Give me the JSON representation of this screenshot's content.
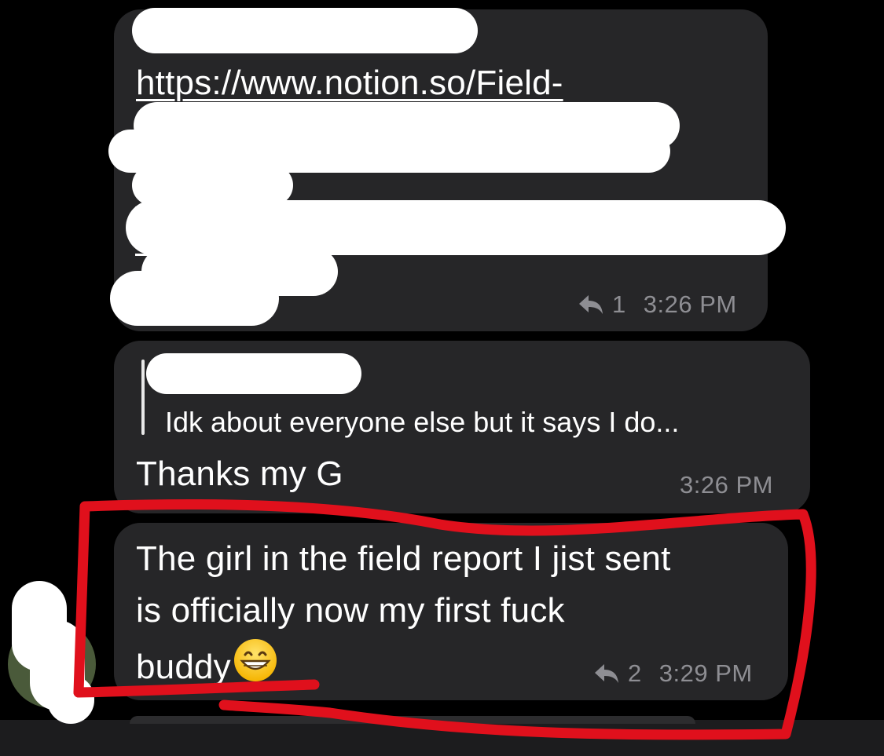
{
  "messages": [
    {
      "link_text": "https://www.notion.so/Field-",
      "reply_count": "1",
      "time": "3:26 PM"
    },
    {
      "quote_text": "Idk about everyone else but it says I do...",
      "text": "Thanks my G",
      "time": "3:26 PM"
    },
    {
      "text_lines": [
        "The girl in the field report I jist sent",
        "is officially now my first fuck",
        "buddy"
      ],
      "emoji": "grinning-face-with-smiling-eyes",
      "reply_count": "2",
      "time": "3:29 PM"
    }
  ],
  "colors": {
    "background": "#000000",
    "bubble": "#262628",
    "meta_text": "#8e8e93",
    "annotation": "#e0101c",
    "redaction": "#ffffff"
  }
}
